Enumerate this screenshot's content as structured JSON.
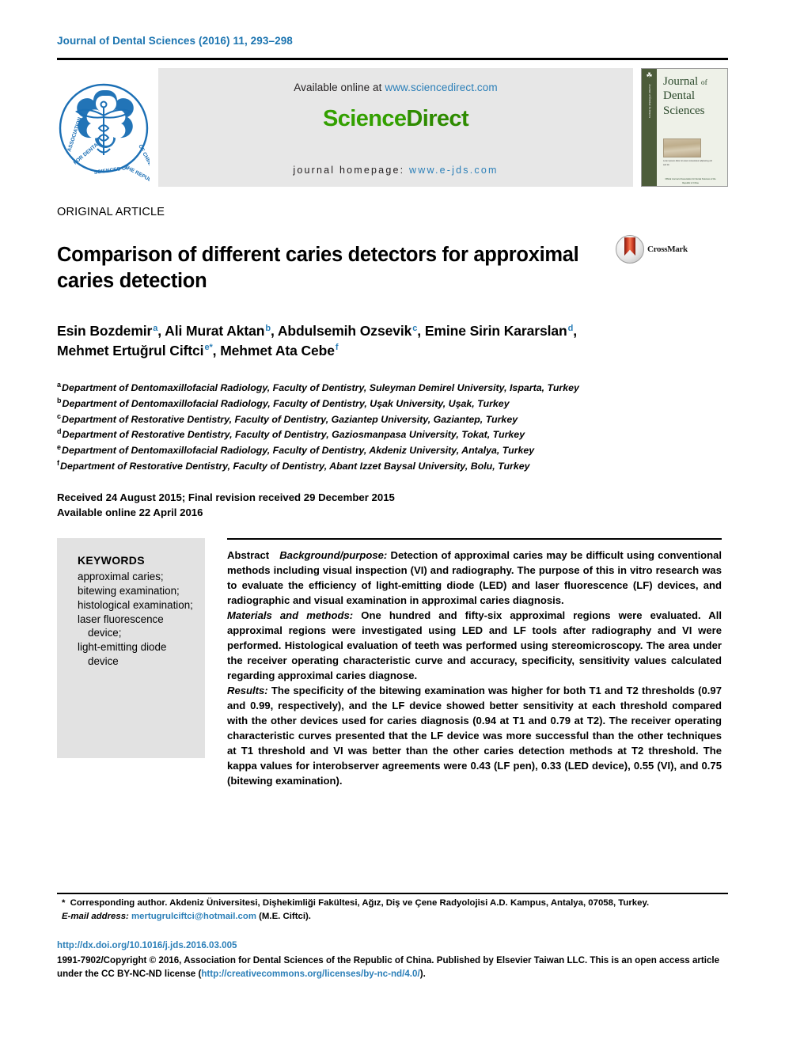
{
  "running_head": "Journal of Dental Sciences (2016) 11, 293–298",
  "masthead": {
    "society_logo_name": "dental-association-seal",
    "available_prefix": "Available online at ",
    "available_link": "www.sciencedirect.com",
    "wordmark_part1": "Science",
    "wordmark_part2": "Direct",
    "homepage_prefix": "journal homepage: ",
    "homepage_link": "www.e-jds.com",
    "cover": {
      "line1": "Journal",
      "of": "of",
      "line2": "Dental",
      "line3": "Sciences",
      "caption": "Lorem ipsum dolor sit amet consectetur adipiscing elit sed do",
      "footer": "Official Journal of Association for Dental Sciences of the Republic of China"
    }
  },
  "article": {
    "type": "ORIGINAL ARTICLE",
    "title": "Comparison of different caries detectors for approximal caries detection",
    "crossmark_label": "CrossMark",
    "authors": [
      {
        "name": "Esin Bozdemir",
        "sup": "a",
        "sep": ", "
      },
      {
        "name": "Ali Murat Aktan",
        "sup": "b",
        "sep": ", "
      },
      {
        "name": "Abdulsemih Ozsevik",
        "sup": "c",
        "sep": ", "
      },
      {
        "name": "Emine Sirin Kararslan",
        "sup": "d",
        "sep": ", "
      },
      {
        "name": "Mehmet Ertuğrul Ciftci",
        "sup": "e*",
        "sep": ", "
      },
      {
        "name": "Mehmet Ata Cebe",
        "sup": "f",
        "sep": ""
      }
    ],
    "affiliations": [
      {
        "mark": "a",
        "text": "Department of Dentomaxillofacial Radiology, Faculty of Dentistry, Suleyman Demirel University, Isparta, Turkey"
      },
      {
        "mark": "b",
        "text": "Department of Dentomaxillofacial Radiology, Faculty of Dentistry, Uşak University, Uşak, Turkey"
      },
      {
        "mark": "c",
        "text": "Department of Restorative Dentistry, Faculty of Dentistry, Gaziantep University, Gaziantep, Turkey"
      },
      {
        "mark": "d",
        "text": "Department of Restorative Dentistry, Faculty of Dentistry, Gaziosmanpasa University, Tokat, Turkey"
      },
      {
        "mark": "e",
        "text": "Department of Dentomaxillofacial Radiology, Faculty of Dentistry, Akdeniz University, Antalya, Turkey"
      },
      {
        "mark": "f",
        "text": "Department of Restorative Dentistry, Faculty of Dentistry, Abant Izzet Baysal University, Bolu, Turkey"
      }
    ],
    "received_line": "Received 24 August 2015; Final revision received 29 December 2015",
    "available_line": "Available online 22 April 2016"
  },
  "keywords": {
    "heading": "KEYWORDS",
    "items": [
      "approximal caries;",
      "bitewing examination;",
      "histological examination;",
      "laser fluorescence device;",
      "light-emitting diode device"
    ]
  },
  "abstract": {
    "label": "Abstract",
    "sections": [
      {
        "heading": "Background/purpose:",
        "text": " Detection of approximal caries may be difficult using conventional methods including visual inspection (VI) and radiography. The purpose of this in vitro research was to evaluate the efficiency of light-emitting diode (LED) and laser fluorescence (LF) devices, and radiographic and visual examination in approximal caries diagnosis."
      },
      {
        "heading": "Materials and methods:",
        "text": " One hundred and fifty-six approximal regions were evaluated. All approximal regions were investigated using LED and LF tools after radiography and VI were performed. Histological evaluation of teeth was performed using stereomicroscopy. The area under the receiver operating characteristic curve and accuracy, specificity, sensitivity values calculated regarding approximal caries diagnose."
      },
      {
        "heading": "Results:",
        "text": " The specificity of the bitewing examination was higher for both T1 and T2 thresholds (0.97 and 0.99, respectively), and the LF device showed better sensitivity at each threshold compared with the other devices used for caries diagnosis (0.94 at T1 and 0.79 at T2). The receiver operating characteristic curves presented that the LF device was more successful than the other techniques at T1 threshold and VI was better than the other caries detection methods at T2 threshold. The kappa values for interobserver agreements were 0.43 (LF pen), 0.33 (LED device), 0.55 (VI), and 0.75 (bitewing examination)."
      }
    ]
  },
  "footnote": {
    "star": "*",
    "corresponding": " Corresponding author. Akdeniz Üniversitesi, Dişhekimliği Fakültesi, Ağız, Diş ve Çene Radyolojisi A.D. Kampus, Antalya, 07058, Turkey.",
    "email_label": "E-mail address:",
    "email": "mertugrulciftci@hotmail.com",
    "email_suffix": " (M.E. Ciftci)."
  },
  "publishing": {
    "doi": "http://dx.doi.org/10.1016/j.jds.2016.03.005",
    "copyright_pre": "1991-7902/Copyright © 2016, Association for Dental Sciences of the Republic of China. Published by Elsevier Taiwan LLC. This is an open access article under the CC BY-NC-ND license (",
    "license_url": "http://creativecommons.org/licenses/by-nc-nd/4.0/",
    "copyright_post": ")."
  },
  "colors": {
    "link_blue": "#2b7fb8",
    "header_blue": "#1b74b0",
    "sciencedirect_green": "#33a000",
    "keyword_box_gray": "#e2e2e2",
    "masthead_gray": "#e7e7e7"
  }
}
